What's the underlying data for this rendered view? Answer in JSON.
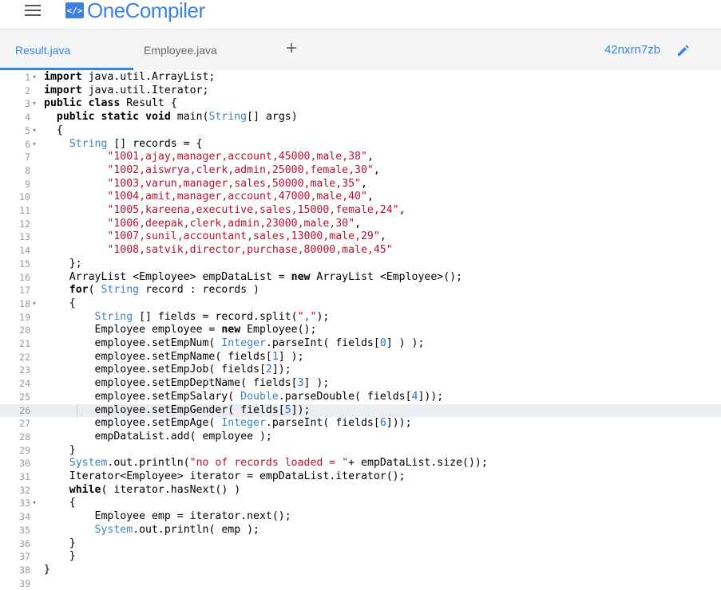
{
  "header": {
    "logo_mark": "</>",
    "logo_text": "OneCompiler"
  },
  "tabs": [
    {
      "label": "Result.java",
      "active": true
    },
    {
      "label": "Employee.java",
      "active": false
    }
  ],
  "add_tab_label": "+",
  "session_id": "42nxrn7zb",
  "active_line": 26,
  "code_lines": [
    {
      "n": "1",
      "fold": true,
      "text": "import java.util.ArrayList;"
    },
    {
      "n": "2",
      "fold": false,
      "text": "import java.util.Iterator;"
    },
    {
      "n": "3",
      "fold": true,
      "text": "public class Result {"
    },
    {
      "n": "4",
      "fold": false,
      "text": "  public static void main(String[] args)"
    },
    {
      "n": "5",
      "fold": true,
      "text": "  {"
    },
    {
      "n": "6",
      "fold": true,
      "text": "    String [] records = {"
    },
    {
      "n": "7",
      "fold": false,
      "text": "          \"1001,ajay,manager,account,45000,male,38\","
    },
    {
      "n": "8",
      "fold": false,
      "text": "          \"1002,aiswrya,clerk,admin,25000,female,30\","
    },
    {
      "n": "9",
      "fold": false,
      "text": "          \"1003,varun,manager,sales,50000,male,35\","
    },
    {
      "n": "10",
      "fold": false,
      "text": "          \"1004,amit,manager,account,47000,male,40\","
    },
    {
      "n": "11",
      "fold": false,
      "text": "          \"1005,kareena,executive,sales,15000,female,24\","
    },
    {
      "n": "12",
      "fold": false,
      "text": "          \"1006,deepak,clerk,admin,23000,male,30\","
    },
    {
      "n": "13",
      "fold": false,
      "text": "          \"1007,sunil,accountant,sales,13000,male,29\","
    },
    {
      "n": "14",
      "fold": false,
      "text": "          \"1008,satvik,director,purchase,80000,male,45\""
    },
    {
      "n": "15",
      "fold": false,
      "text": "    };"
    },
    {
      "n": "16",
      "fold": false,
      "text": "    ArrayList <Employee> empDataList = new ArrayList <Employee>();"
    },
    {
      "n": "17",
      "fold": false,
      "text": "    for( String record : records )"
    },
    {
      "n": "18",
      "fold": true,
      "text": "    {"
    },
    {
      "n": "19",
      "fold": false,
      "text": "        String [] fields = record.split(\",\");"
    },
    {
      "n": "20",
      "fold": false,
      "text": "        Employee employee = new Employee();"
    },
    {
      "n": "21",
      "fold": false,
      "text": "        employee.setEmpNum( Integer.parseInt( fields[0] ) );"
    },
    {
      "n": "22",
      "fold": false,
      "text": "        employee.setEmpName( fields[1] );"
    },
    {
      "n": "23",
      "fold": false,
      "text": "        employee.setEmpJob( fields[2]);"
    },
    {
      "n": "24",
      "fold": false,
      "text": "        employee.setEmpDeptName( fields[3] );"
    },
    {
      "n": "25",
      "fold": false,
      "text": "        employee.setEmpSalary( Double.parseDouble( fields[4]));"
    },
    {
      "n": "26",
      "fold": false,
      "text": "        employee.setEmpGender( fields[5]);"
    },
    {
      "n": "27",
      "fold": false,
      "text": "        employee.setEmpAge( Integer.parseInt( fields[6]));"
    },
    {
      "n": "28",
      "fold": false,
      "text": "        empDataList.add( employee );"
    },
    {
      "n": "29",
      "fold": false,
      "text": "    }"
    },
    {
      "n": "30",
      "fold": false,
      "text": "    System.out.println(\"no of records loaded = \"+ empDataList.size());"
    },
    {
      "n": "31",
      "fold": false,
      "text": "    Iterator<Employee> iterator = empDataList.iterator();"
    },
    {
      "n": "32",
      "fold": false,
      "text": "    while( iterator.hasNext() )"
    },
    {
      "n": "33",
      "fold": true,
      "text": "    {"
    },
    {
      "n": "34",
      "fold": false,
      "text": "        Employee emp = iterator.next();"
    },
    {
      "n": "35",
      "fold": false,
      "text": "        System.out.println( emp );"
    },
    {
      "n": "36",
      "fold": false,
      "text": "    }"
    },
    {
      "n": "37",
      "fold": false,
      "text": "    }"
    },
    {
      "n": "38",
      "fold": false,
      "text": "}"
    },
    {
      "n": "39",
      "fold": false,
      "text": ""
    }
  ],
  "colors": {
    "brand": "#3b82e0",
    "string": "#b5132f",
    "type": "#3b82c4",
    "number": "#2b6fbf"
  },
  "icons": {
    "menu": "hamburger-icon",
    "edit": "pencil-icon",
    "fold": "fold-arrow-icon"
  }
}
